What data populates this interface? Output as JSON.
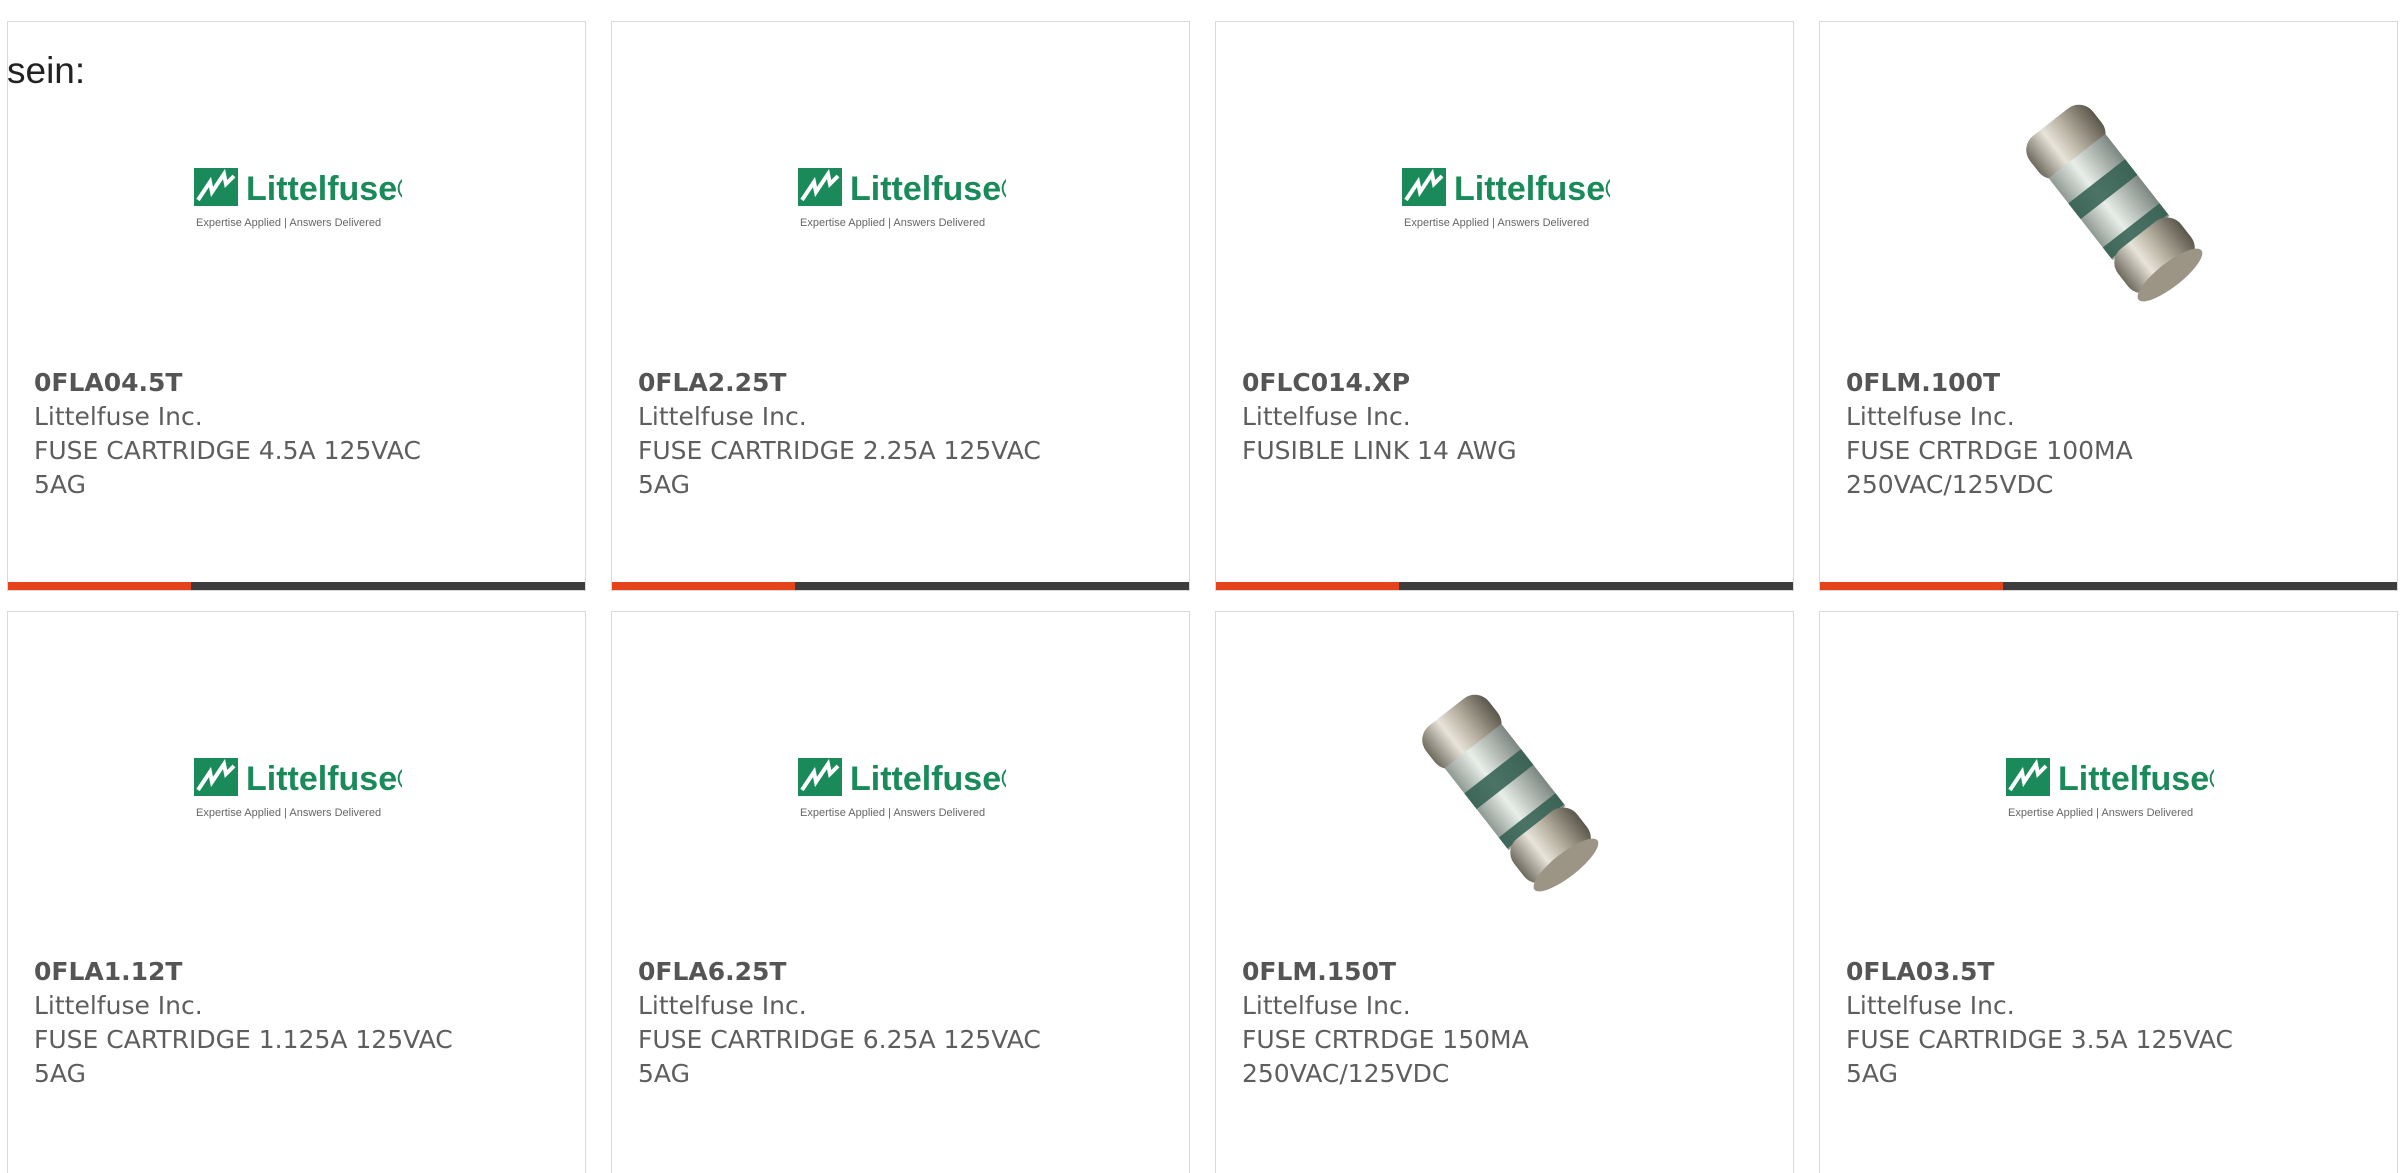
{
  "intro_text": "sein:",
  "brand": {
    "name": "Littelfuse",
    "trademark": "®",
    "tagline_left": "Expertise Applied",
    "tagline_right": "Answers Delivered",
    "color": "#1a8a5a"
  },
  "accent_color": "#e4431c",
  "bar_color": "#3d3d3d",
  "products": [
    {
      "part_number": "0FLA04.5T",
      "manufacturer": "Littelfuse Inc.",
      "description": "FUSE CARTRIDGE 4.5A 125VAC 5AG",
      "image": "littelfuse-logo"
    },
    {
      "part_number": "0FLA2.25T",
      "manufacturer": "Littelfuse Inc.",
      "description": "FUSE CARTRIDGE 2.25A 125VAC 5AG",
      "image": "littelfuse-logo"
    },
    {
      "part_number": "0FLC014.XP",
      "manufacturer": "Littelfuse Inc.",
      "description": "FUSIBLE LINK 14 AWG",
      "image": "littelfuse-logo"
    },
    {
      "part_number": "0FLM.100T",
      "manufacturer": "Littelfuse Inc.",
      "description": "FUSE CRTRDGE 100MA 250VAC/125VDC",
      "image": "cartridge-fuse-photo"
    },
    {
      "part_number": "0FLA1.12T",
      "manufacturer": "Littelfuse Inc.",
      "description": "FUSE CARTRIDGE 1.125A 125VAC 5AG",
      "image": "littelfuse-logo"
    },
    {
      "part_number": "0FLA6.25T",
      "manufacturer": "Littelfuse Inc.",
      "description": "FUSE CARTRIDGE 6.25A 125VAC 5AG",
      "image": "littelfuse-logo"
    },
    {
      "part_number": "0FLM.150T",
      "manufacturer": "Littelfuse Inc.",
      "description": "FUSE CRTRDGE 150MA 250VAC/125VDC",
      "image": "cartridge-fuse-photo"
    },
    {
      "part_number": "0FLA03.5T",
      "manufacturer": "Littelfuse Inc.",
      "description": "FUSE CARTRIDGE 3.5A 125VAC 5AG",
      "image": "littelfuse-logo"
    }
  ]
}
